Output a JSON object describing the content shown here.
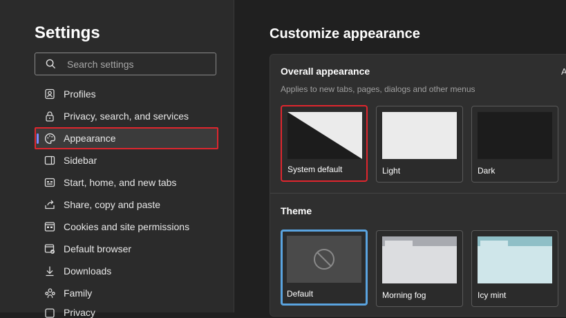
{
  "sidebar": {
    "title": "Settings",
    "search_placeholder": "Search settings",
    "items": [
      {
        "label": "Profiles",
        "icon": "profile-icon"
      },
      {
        "label": "Privacy, search, and services",
        "icon": "lock-icon"
      },
      {
        "label": "Appearance",
        "icon": "palette-icon",
        "active": true
      },
      {
        "label": "Sidebar",
        "icon": "sidebar-icon"
      },
      {
        "label": "Start, home, and new tabs",
        "icon": "home-tabs-icon"
      },
      {
        "label": "Share, copy and paste",
        "icon": "share-icon"
      },
      {
        "label": "Cookies and site permissions",
        "icon": "cookies-icon"
      },
      {
        "label": "Default browser",
        "icon": "browser-icon"
      },
      {
        "label": "Downloads",
        "icon": "download-icon"
      },
      {
        "label": "Family",
        "icon": "family-icon"
      },
      {
        "label": "Privacy",
        "icon": "generic-icon"
      }
    ]
  },
  "main": {
    "title": "Customize appearance",
    "overall": {
      "title": "Overall appearance",
      "subtitle": "Applies to new tabs, pages, dialogs and other menus",
      "clipped_text": "A",
      "options": [
        {
          "label": "System default",
          "selected": true
        },
        {
          "label": "Light"
        },
        {
          "label": "Dark"
        }
      ]
    },
    "theme": {
      "title": "Theme",
      "options": [
        {
          "label": "Default",
          "selected": true
        },
        {
          "label": "Morning fog"
        },
        {
          "label": "Icy mint"
        }
      ]
    }
  },
  "colors": {
    "accent": "#7a8cff",
    "highlight_red": "#e0262e",
    "selected_blue": "#5aa4e0",
    "sidebar_bg": "#2b2b2b",
    "page_bg": "#202020"
  }
}
